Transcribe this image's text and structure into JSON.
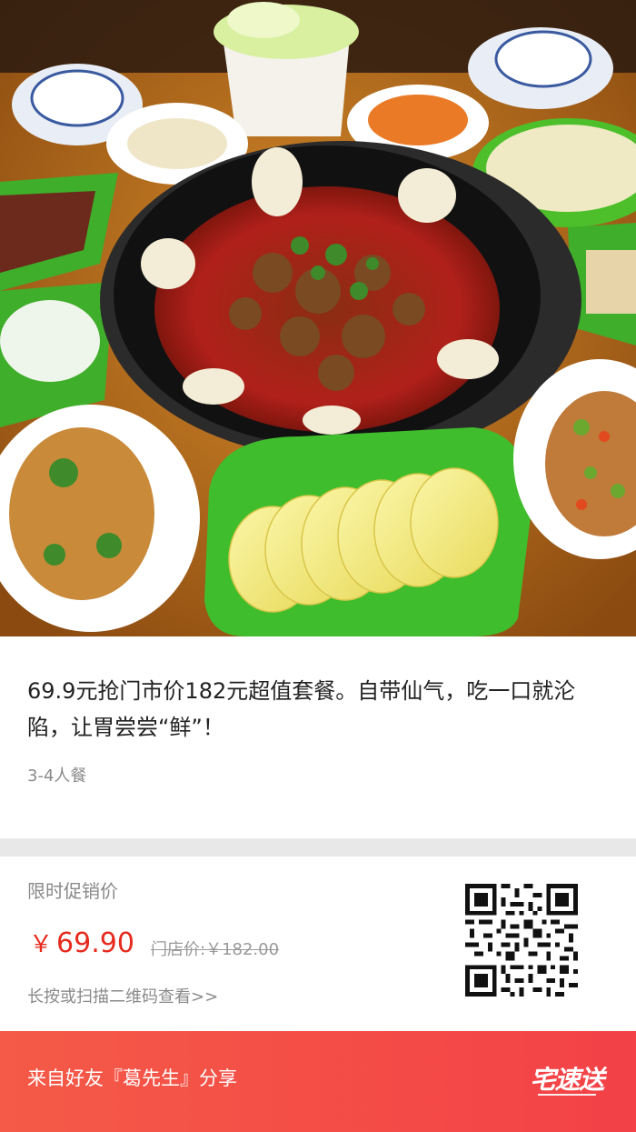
{
  "product": {
    "title": "69.9元抢门市价182元超值套餐。自带仙气，吃一口就沦陷，让胃尝尝“鲜”！",
    "subtitle": "3-4人餐"
  },
  "promo": {
    "label": "限时促销价",
    "currency": "￥",
    "price": "69.90",
    "store_price": "门店价:￥182.00",
    "hint": "长按或扫描二维码查看>>"
  },
  "footer": {
    "share_text": "来自好友『葛先生』分享",
    "brand": "宅速送"
  },
  "colors": {
    "price": "#e62b1e",
    "footer_start": "#f45a47",
    "footer_end": "#f34147"
  },
  "icons": {
    "qr": "qr-code-icon",
    "brand": "brand-logo-icon"
  }
}
